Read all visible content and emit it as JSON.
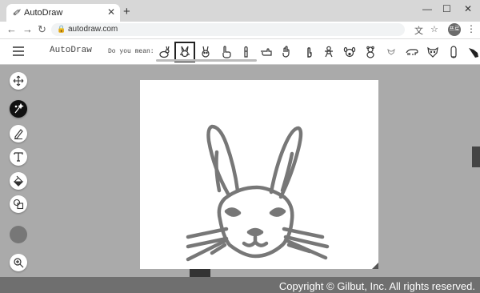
{
  "browser": {
    "tab_title": "AutoDraw",
    "tab_favicon_glyph": "✐",
    "close_glyph": "✕",
    "newtab_glyph": "+",
    "win_min": "—",
    "win_max": "☐",
    "win_close": "✕",
    "back_glyph": "←",
    "forward_glyph": "→",
    "reload_glyph": "↻",
    "lock_glyph": "🔒",
    "url": "autodraw.com",
    "translate_glyph": "文",
    "star_glyph": "☆",
    "profile_text": "프로",
    "menu_glyph": "⋮"
  },
  "app": {
    "brand": "AutoDraw",
    "did_you_mean": "Do you mean:",
    "suggestions": [
      {
        "name": "rabbit-sitting-icon"
      },
      {
        "name": "rabbit-face-icon",
        "selected": true
      },
      {
        "name": "bunny-face-icon"
      },
      {
        "name": "pointing-hand-icon"
      },
      {
        "name": "raised-finger-icon"
      },
      {
        "name": "hand-point-icon"
      },
      {
        "name": "hand-gesture-icon"
      },
      {
        "name": "gingerbread-icon"
      },
      {
        "name": "dog-face-icon"
      },
      {
        "name": "teddy-bear-icon"
      },
      {
        "name": "cat-face-icon"
      },
      {
        "name": "bear-icon"
      },
      {
        "name": "lion-face-icon"
      },
      {
        "name": "penguin-icon"
      },
      {
        "name": "bird-icon"
      }
    ],
    "tools": [
      {
        "name": "move-tool-icon"
      },
      {
        "name": "autodraw-tool-icon",
        "active": true
      },
      {
        "name": "draw-tool-icon"
      },
      {
        "name": "text-tool-icon"
      },
      {
        "name": "fill-tool-icon"
      },
      {
        "name": "shape-tool-icon"
      },
      {
        "name": "zoom-tool-icon"
      }
    ],
    "current_color": "#777777"
  },
  "footer": {
    "copyright": "Copyright © Gilbut, Inc. All rights reserved."
  }
}
